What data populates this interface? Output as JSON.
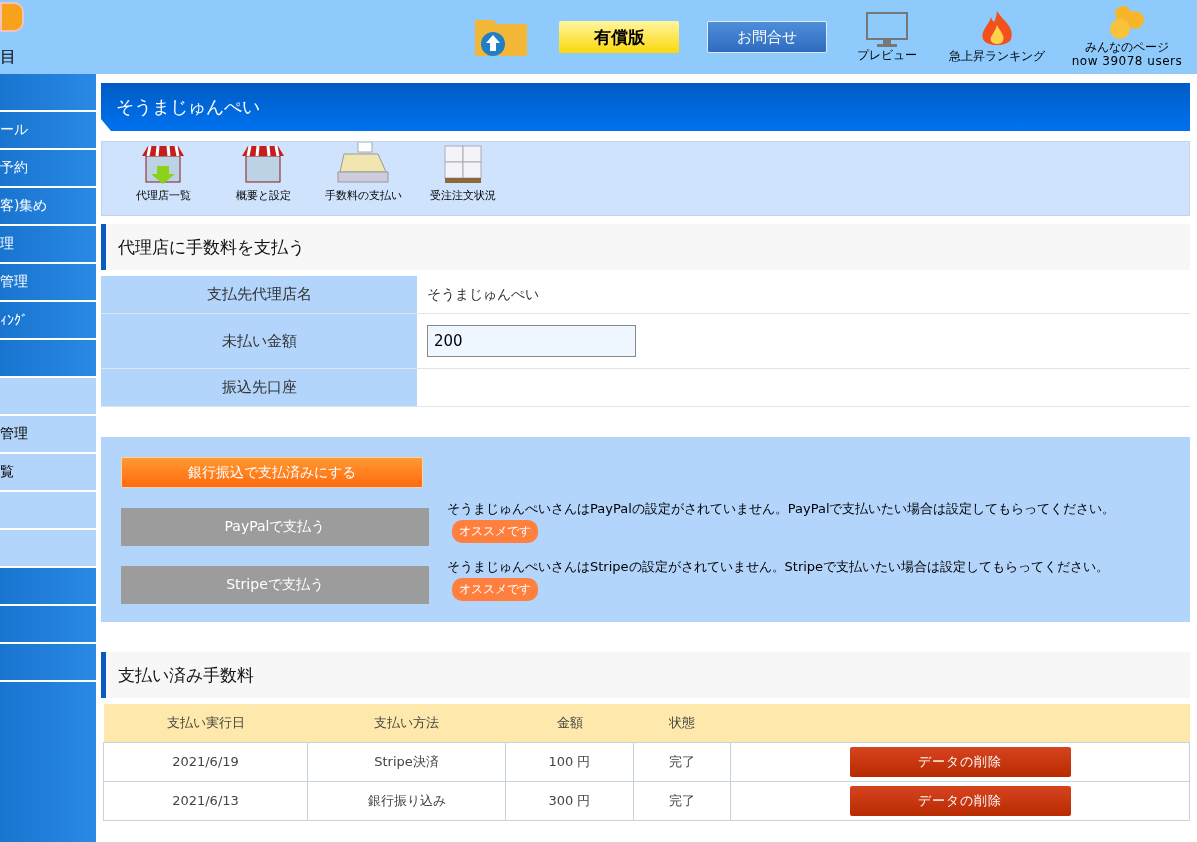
{
  "header": {
    "logo_label": "目",
    "paid_button": "有償版",
    "contact_button": "お問合せ",
    "preview": "プレビュー",
    "ranking": "急上昇ランキング",
    "everyone": "みんなのページ",
    "users": "now 39078 users"
  },
  "sidebar": [
    {
      "kind": "dark"
    },
    {
      "label": "ール",
      "kind": "dark"
    },
    {
      "label": "予約",
      "kind": "dark"
    },
    {
      "label": "客)集め",
      "kind": "dark"
    },
    {
      "label": "理",
      "kind": "dark"
    },
    {
      "label": "管理",
      "kind": "dark"
    },
    {
      "label": "ｨﾝｸﾞ",
      "kind": "dark"
    },
    {
      "kind": "dark"
    },
    {
      "kind": "light"
    },
    {
      "label": "管理",
      "kind": "light"
    },
    {
      "label": "覧",
      "kind": "light"
    },
    {
      "kind": "light"
    },
    {
      "kind": "light"
    },
    {
      "kind": "dark"
    },
    {
      "kind": "dark"
    },
    {
      "kind": "dark"
    }
  ],
  "page_title": "そうまじゅんぺい",
  "toolbar": [
    {
      "label": "代理店一覧",
      "kind": "shop-down"
    },
    {
      "label": "概要と設定",
      "kind": "shop"
    },
    {
      "label": "手数料の支払い",
      "kind": "register"
    },
    {
      "label": "受注注文状況",
      "kind": "boxes"
    }
  ],
  "pay_section": {
    "title": "代理店に手数料を支払う",
    "rows": [
      {
        "label": "支払先代理店名",
        "value": "そうまじゅんぺい",
        "kind": "text"
      },
      {
        "label": "未払い金額",
        "value": "200",
        "kind": "input"
      },
      {
        "label": "振込先口座",
        "kind": "text"
      }
    ]
  },
  "actions": {
    "bank_button": "銀行振込で支払済みにする",
    "methods": [
      {
        "button": "PayPalで支払う",
        "note": "そうまじゅんぺいさんはPayPalの設定がされていません。PayPalで支払いたい場合は設定してもらってください。",
        "badge": "オススメです"
      },
      {
        "button": "Stripeで支払う",
        "note": "そうまじゅんぺいさんはStripeの設定がされていません。Stripeで支払いたい場合は設定してもらってください。",
        "badge": "オススメです"
      }
    ]
  },
  "paid_section": {
    "title": "支払い済み手数料",
    "columns": [
      "支払い実行日",
      "支払い方法",
      "金額",
      "状態"
    ],
    "rows": [
      {
        "date": "2021/6/19",
        "method": "Stripe決済",
        "amount": "100 円",
        "status": "完了",
        "action": "データの削除"
      },
      {
        "date": "2021/6/13",
        "method": "銀行振り込み",
        "amount": "300 円",
        "status": "完了",
        "action": "データの削除"
      }
    ]
  }
}
